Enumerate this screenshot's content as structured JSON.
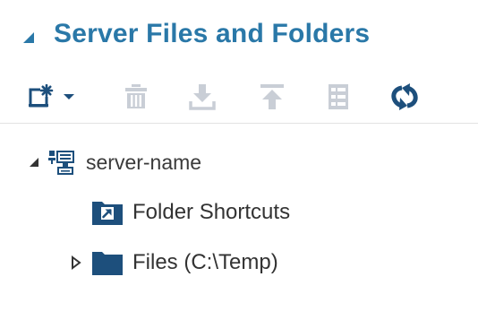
{
  "panel": {
    "title": "Server Files and Folders",
    "accent_color": "#2a78a8",
    "icon_color": "#1d4f7c",
    "disabled_icon_color": "#c9ced6",
    "expanded": true
  },
  "toolbar": {
    "items": [
      {
        "name": "new",
        "icon": "new-item-icon",
        "has_dropdown": true,
        "enabled": true
      },
      {
        "name": "delete",
        "icon": "trash-icon",
        "enabled": false
      },
      {
        "name": "download",
        "icon": "download-icon",
        "enabled": false
      },
      {
        "name": "upload",
        "icon": "upload-icon",
        "enabled": false
      },
      {
        "name": "properties",
        "icon": "properties-list-icon",
        "enabled": false
      },
      {
        "name": "refresh",
        "icon": "refresh-icon",
        "enabled": true
      }
    ]
  },
  "tree": {
    "server": {
      "label": "server-name",
      "icon": "server-icon",
      "expanded": true
    },
    "children": [
      {
        "label": "Folder Shortcuts",
        "icon": "folder-shortcut-icon",
        "expandable": false
      },
      {
        "label": "Files (C:\\Temp)",
        "icon": "folder-icon",
        "expandable": true,
        "expanded": false
      }
    ]
  }
}
